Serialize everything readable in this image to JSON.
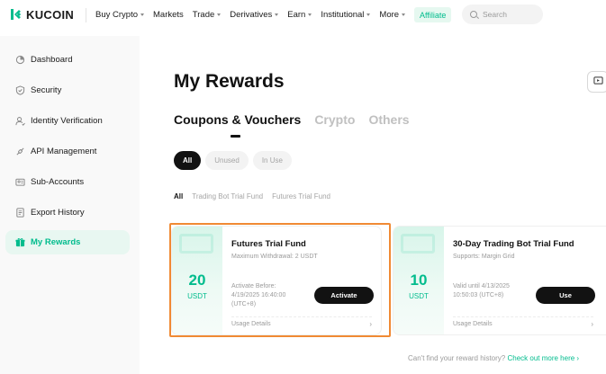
{
  "header": {
    "brand": "KUCOIN",
    "nav": [
      {
        "label": "Buy Crypto",
        "caret": true
      },
      {
        "label": "Markets",
        "caret": false
      },
      {
        "label": "Trade",
        "caret": true
      },
      {
        "label": "Derivatives",
        "caret": true
      },
      {
        "label": "Earn",
        "caret": true
      },
      {
        "label": "Institutional",
        "caret": true
      },
      {
        "label": "More",
        "caret": true
      }
    ],
    "affiliate": "Affiliate",
    "search_placeholder": "Search"
  },
  "sidebar": {
    "items": [
      {
        "label": "Dashboard",
        "icon": "dashboard-icon",
        "active": false
      },
      {
        "label": "Security",
        "icon": "shield-icon",
        "active": false
      },
      {
        "label": "Identity Verification",
        "icon": "identity-icon",
        "active": false
      },
      {
        "label": "API Management",
        "icon": "api-icon",
        "active": false
      },
      {
        "label": "Sub-Accounts",
        "icon": "sub-accounts-icon",
        "active": false
      },
      {
        "label": "Export History",
        "icon": "export-icon",
        "active": false
      },
      {
        "label": "My Rewards",
        "icon": "gift-icon",
        "active": true
      }
    ]
  },
  "main": {
    "title": "My Rewards",
    "tabs": [
      {
        "label": "Coupons & Vouchers",
        "active": true
      },
      {
        "label": "Crypto",
        "active": false
      },
      {
        "label": "Others",
        "active": false
      }
    ],
    "status_filters": [
      {
        "label": "All",
        "active": true
      },
      {
        "label": "Unused",
        "active": false
      },
      {
        "label": "In Use",
        "active": false
      }
    ],
    "type_filters": [
      {
        "label": "All",
        "active": true
      },
      {
        "label": "Trading Bot Trial Fund",
        "active": false
      },
      {
        "label": "Futures Trial Fund",
        "active": false
      }
    ],
    "cards": [
      {
        "amount": "20",
        "unit": "USDT",
        "title": "Futures Trial Fund",
        "subtitle": "Maximum Withdrawal: 2 USDT",
        "date_text": "Activate Before: 4/19/2025 16:40:00 (UTC+8)",
        "button": "Activate",
        "details": "Usage Details",
        "highlighted": true
      },
      {
        "amount": "10",
        "unit": "USDT",
        "title": "30-Day Trading Bot Trial Fund",
        "subtitle": "Supports: Margin Grid",
        "date_text": "Valid until 4/13/2025 10:50:03 (UTC+8)",
        "button": "Use",
        "details": "Usage Details",
        "highlighted": false
      }
    ],
    "footer_text": "Can't find your reward history?",
    "footer_link": "Check out more here"
  },
  "colors": {
    "accent": "#01bc8d",
    "highlight": "#f08a34",
    "text": "#121212"
  }
}
